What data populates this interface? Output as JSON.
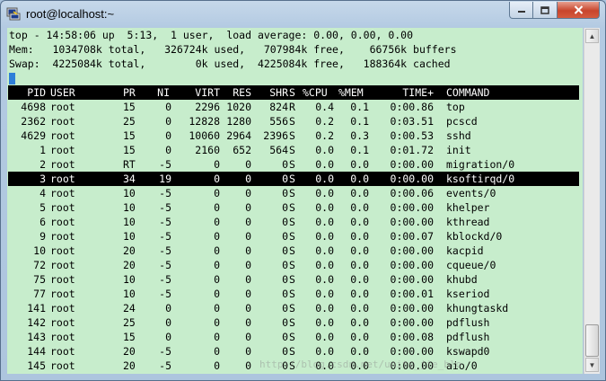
{
  "window": {
    "title": "root@localhost:~",
    "minimize_icon": "minimize-icon",
    "maximize_icon": "maximize-icon",
    "close_icon": "close-icon"
  },
  "summary": {
    "line1": "top - 14:58:06 up  5:13,  1 user,  load average: 0.00, 0.00, 0.00",
    "line2": "Mem:   1034708k total,   326724k used,   707984k free,    66756k buffers",
    "line3": "Swap:  4225084k total,        0k used,  4225084k free,   188364k cached"
  },
  "columns": [
    "PID",
    "USER",
    "PR",
    "NI",
    "VIRT",
    "RES",
    "SHR",
    "S",
    "%CPU",
    "%MEM",
    "TIME+",
    "COMMAND"
  ],
  "processes": [
    [
      "4698",
      "root",
      "15",
      "0",
      "2296",
      "1020",
      "824",
      "R",
      "0.4",
      "0.1",
      "0:00.86",
      "top"
    ],
    [
      "2362",
      "root",
      "25",
      "0",
      "12828",
      "1280",
      "556",
      "S",
      "0.2",
      "0.1",
      "0:03.51",
      "pcscd"
    ],
    [
      "4629",
      "root",
      "15",
      "0",
      "10060",
      "2964",
      "2396",
      "S",
      "0.2",
      "0.3",
      "0:00.53",
      "sshd"
    ],
    [
      "1",
      "root",
      "15",
      "0",
      "2160",
      "652",
      "564",
      "S",
      "0.0",
      "0.1",
      "0:01.72",
      "init"
    ],
    [
      "2",
      "root",
      "RT",
      "-5",
      "0",
      "0",
      "0",
      "S",
      "0.0",
      "0.0",
      "0:00.00",
      "migration/0"
    ],
    [
      "3",
      "root",
      "34",
      "19",
      "0",
      "0",
      "0",
      "S",
      "0.0",
      "0.0",
      "0:00.00",
      "ksoftirqd/0"
    ],
    [
      "4",
      "root",
      "10",
      "-5",
      "0",
      "0",
      "0",
      "S",
      "0.0",
      "0.0",
      "0:00.06",
      "events/0"
    ],
    [
      "5",
      "root",
      "10",
      "-5",
      "0",
      "0",
      "0",
      "S",
      "0.0",
      "0.0",
      "0:00.00",
      "khelper"
    ],
    [
      "6",
      "root",
      "10",
      "-5",
      "0",
      "0",
      "0",
      "S",
      "0.0",
      "0.0",
      "0:00.00",
      "kthread"
    ],
    [
      "9",
      "root",
      "10",
      "-5",
      "0",
      "0",
      "0",
      "S",
      "0.0",
      "0.0",
      "0:00.07",
      "kblockd/0"
    ],
    [
      "10",
      "root",
      "20",
      "-5",
      "0",
      "0",
      "0",
      "S",
      "0.0",
      "0.0",
      "0:00.00",
      "kacpid"
    ],
    [
      "72",
      "root",
      "20",
      "-5",
      "0",
      "0",
      "0",
      "S",
      "0.0",
      "0.0",
      "0:00.00",
      "cqueue/0"
    ],
    [
      "75",
      "root",
      "10",
      "-5",
      "0",
      "0",
      "0",
      "S",
      "0.0",
      "0.0",
      "0:00.00",
      "khubd"
    ],
    [
      "77",
      "root",
      "10",
      "-5",
      "0",
      "0",
      "0",
      "S",
      "0.0",
      "0.0",
      "0:00.01",
      "kseriod"
    ],
    [
      "141",
      "root",
      "24",
      "0",
      "0",
      "0",
      "0",
      "S",
      "0.0",
      "0.0",
      "0:00.00",
      "khungtaskd"
    ],
    [
      "142",
      "root",
      "25",
      "0",
      "0",
      "0",
      "0",
      "S",
      "0.0",
      "0.0",
      "0:00.00",
      "pdflush"
    ],
    [
      "143",
      "root",
      "15",
      "0",
      "0",
      "0",
      "0",
      "S",
      "0.0",
      "0.0",
      "0:00.08",
      "pdflush"
    ],
    [
      "144",
      "root",
      "20",
      "-5",
      "0",
      "0",
      "0",
      "S",
      "0.0",
      "0.0",
      "0:00.00",
      "kswapd0"
    ],
    [
      "145",
      "root",
      "20",
      "-5",
      "0",
      "0",
      "0",
      "S",
      "0.0",
      "0.0",
      "0:00.00",
      "aio/0"
    ]
  ],
  "highlighted_index": 5,
  "watermark": "http://blog.csdn.net/unity_jie_blo",
  "colors": {
    "terminal_bg": "#c7edcc",
    "terminal_fg": "#000000",
    "header_bg": "#000000",
    "header_fg": "#ffffff",
    "cursor": "#2f7fd8",
    "close_button": "#c8452c"
  }
}
